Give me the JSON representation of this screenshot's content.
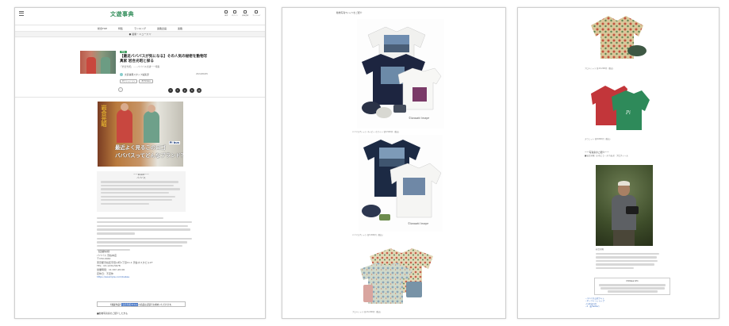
{
  "site": {
    "logo": "文遊事典",
    "header_icons": [
      "検索",
      "ログイン",
      "会員登録",
      "マイページ"
    ],
    "nav": [
      "総合TOP",
      "特集",
      "ランキング",
      "連載企画",
      "連載"
    ],
    "breadcrumb": "● 最新・ニュース ▽"
  },
  "article": {
    "tag": "特集",
    "title": "【最近バババスが気になる】その人気の秘密を動物写真家 岩合光昭と探る",
    "subtitle": "「岩合光昭」……バババスの謎ーー特集",
    "author": "文遊事典スタッフ編集部",
    "date": "2024/06/05",
    "chips": [
      "#ファッション",
      "#Chillasa"
    ],
    "share_icons": [
      "f",
      "t",
      "p",
      "h",
      "@"
    ],
    "hero": {
      "vertical_text": "岩合光昭",
      "caption_line1": "最近よく見るこのロゴ",
      "caption_line2": "バババスってどんなブランド？",
      "brandmark": "Pi bus"
    },
    "summary_title": "ーーPOINTーー",
    "summary_sub": "バババス",
    "store": {
      "header": "【店舗情報】",
      "lines": [
        "バババス 渋谷本店",
        "〒150-0042",
        "東京都渋谷区宇田川町1丁目11-1 渋谷ホスタビル1F",
        "TEL：03-1234-5678",
        "営業時間：11:00〜20:00",
        "定休日：不定休",
        "https://example.com/babas"
      ]
    },
    "notice_pre": "【掲載作品】",
    "notice_highlight": "岩合光昭 Pi bus",
    "notice_post": "の商品は店舗でお求めいただけます。",
    "footnote": "■動物写真家のご紹介した方も"
  },
  "page2": {
    "caption_top": "動物写真Tシャツをご紹介",
    "photo_credits": [
      "©Iwasaki Image",
      "©Iwasaki Image"
    ],
    "captions": [
      "バババスTシャツ ネイビー ホワイト 各5,500円（税込）",
      "バババスTシャツ 各5,500円（税込）",
      "アロハシャツ 各13,200円（税込）"
    ]
  },
  "page3": {
    "captions": [
      "アロハシャツ 各13,200円（税込）",
      "スウェット 各8,800円（税込）",
      "ーー写真家のご紹介ーー",
      "■岩合光昭（いわごう・みつあき）プロフィール"
    ],
    "photo_caption": "岩合光昭",
    "end_title": "Chillasa Info",
    "end_links": [
      "・バババス公式サイト",
      "・オンラインショップ",
      "・Instagram",
      "・X（旧Twitter）"
    ]
  }
}
